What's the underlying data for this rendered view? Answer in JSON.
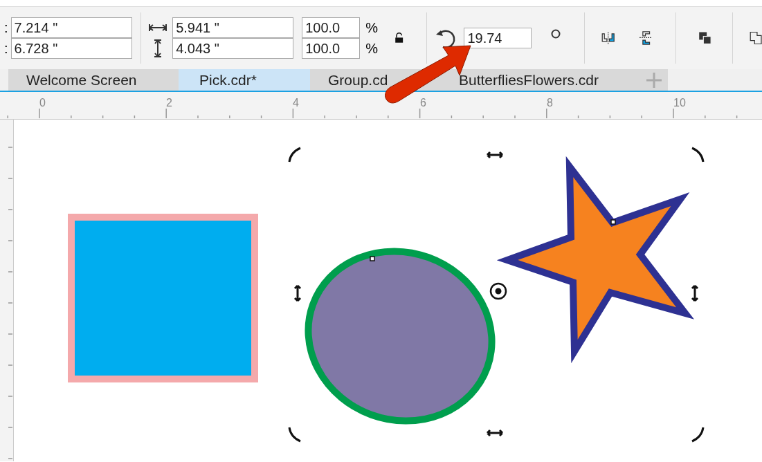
{
  "toolbar": {
    "position": [
      {
        "label": ":",
        "value": "7.214 \""
      },
      {
        "label": ":",
        "value": "6.728 \""
      }
    ],
    "size": [
      {
        "kind": "width",
        "value": "5.941 \""
      },
      {
        "kind": "height",
        "value": "4.043 \""
      }
    ],
    "scale": [
      {
        "value": "100.0",
        "unit": "%"
      },
      {
        "value": "100.0",
        "unit": "%"
      }
    ],
    "lock_ratio": false,
    "rotation": {
      "value": "19.74"
    }
  },
  "tabs": [
    {
      "label": "Welcome Screen",
      "selected": false
    },
    {
      "label": "Pick.cdr*",
      "selected": true
    },
    {
      "label": "Group.cd",
      "selected": false
    },
    {
      "label": "ButterfliesFlowers.cdr",
      "selected": false
    }
  ],
  "ruler": [
    "0",
    "2",
    "4",
    "6",
    "8",
    "10"
  ],
  "canvas": {
    "objects": [
      {
        "kind": "square"
      },
      {
        "kind": "ellipse"
      },
      {
        "kind": "star"
      }
    ]
  }
}
